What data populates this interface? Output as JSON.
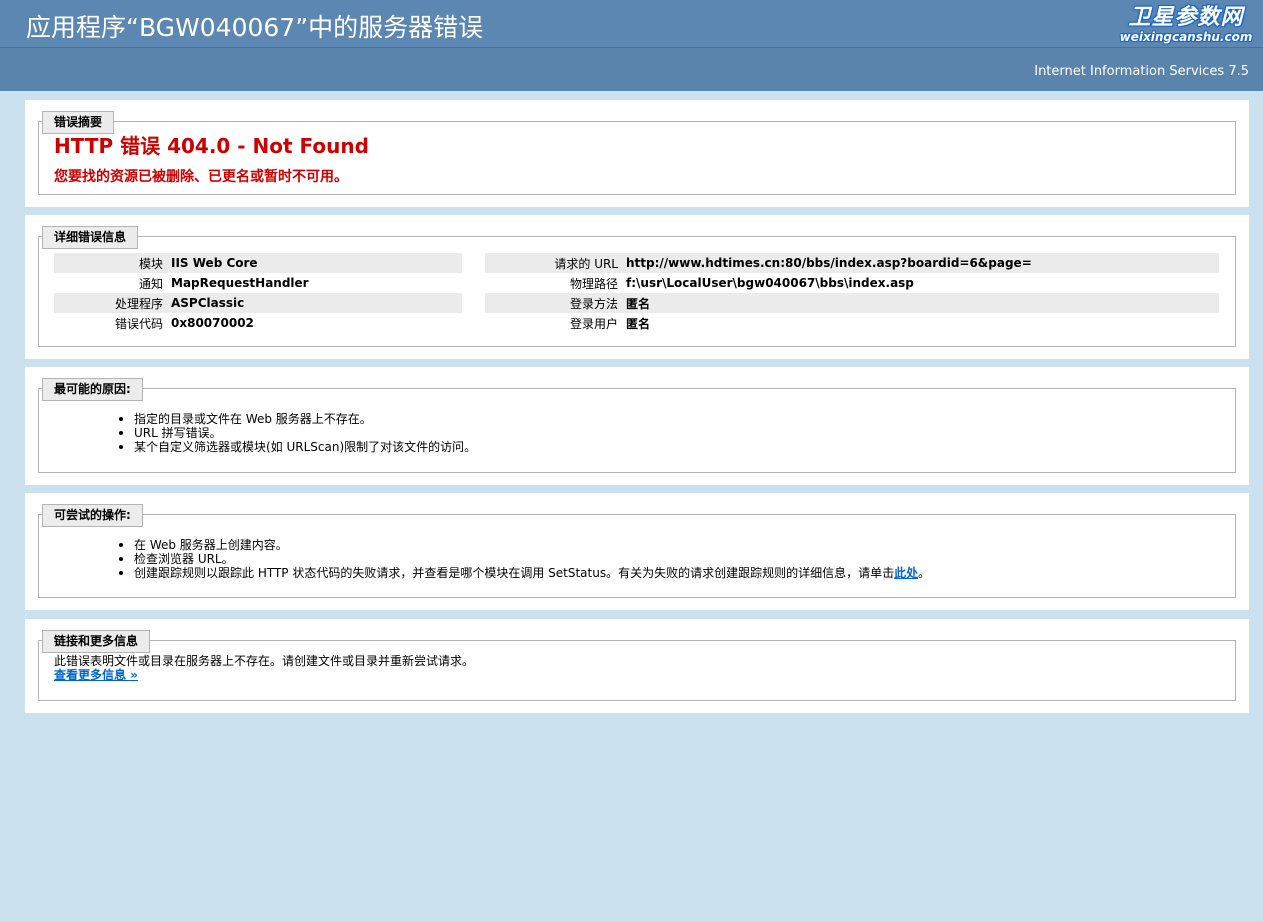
{
  "header": {
    "title": "应用程序“BGW040067”中的服务器错误",
    "logo_line1": "卫星参数网",
    "logo_line2": "weixingcanshu.com",
    "server": "Internet Information Services 7.5"
  },
  "summary": {
    "legend": "错误摘要",
    "title": "HTTP 错误 404.0 - Not Found",
    "subtitle": "您要找的资源已被删除、已更名或暂时不可用。"
  },
  "details": {
    "legend": "详细错误信息",
    "left": [
      {
        "key": "模块",
        "value": "IIS Web Core"
      },
      {
        "key": "通知",
        "value": "MapRequestHandler"
      },
      {
        "key": "处理程序",
        "value": "ASPClassic"
      },
      {
        "key": "错误代码",
        "value": "0x80070002"
      }
    ],
    "right": [
      {
        "key": "请求的 URL",
        "value": "http://www.hdtimes.cn:80/bbs/index.asp?boardid=6&page="
      },
      {
        "key": "物理路径",
        "value": "f:\\usr\\LocalUser\\bgw040067\\bbs\\index.asp"
      },
      {
        "key": "登录方法",
        "value": "匿名"
      },
      {
        "key": "登录用户",
        "value": "匿名"
      }
    ]
  },
  "causes": {
    "legend": "最可能的原因:",
    "items": [
      "指定的目录或文件在 Web 服务器上不存在。",
      "URL 拼写错误。",
      "某个自定义筛选器或模块(如 URLScan)限制了对该文件的访问。"
    ]
  },
  "actions": {
    "legend": "可尝试的操作:",
    "items": [
      "在 Web 服务器上创建内容。",
      "检查浏览器 URL。"
    ],
    "item3_text": "创建跟踪规则以跟踪此 HTTP 状态代码的失败请求，并查看是哪个模块在调用 SetStatus。有关为失败的请求创建跟踪规则的详细信息，请单击",
    "item3_link": "此处",
    "item3_end": "。"
  },
  "links": {
    "legend": "链接和更多信息",
    "text": "此错误表明文件或目录在服务器上不存在。请创建文件或目录并重新尝试请求。",
    "more_link": "查看更多信息 »"
  }
}
